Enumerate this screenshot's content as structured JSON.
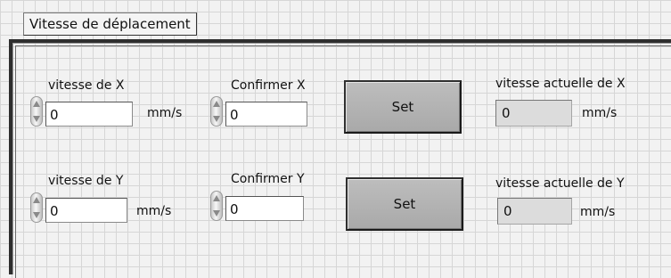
{
  "panel": {
    "title": "Vitesse de déplacement"
  },
  "rows": [
    {
      "speed_label": "vitesse de X",
      "speed_value": "0",
      "unit": "mm/s",
      "confirm_label": "Confirmer X",
      "confirm_value": "0",
      "set_label": "Set",
      "current_label": "vitesse actuelle de X",
      "current_value": "0",
      "current_unit": "mm/s"
    },
    {
      "speed_label": "vitesse de Y",
      "speed_value": "0",
      "unit": "mm/s",
      "confirm_label": "Confirmer Y",
      "confirm_value": "0",
      "set_label": "Set",
      "current_label": "vitesse actuelle de Y",
      "current_value": "0",
      "current_unit": "mm/s"
    }
  ],
  "icons": {
    "spinner": "increment-decrement-icon"
  }
}
